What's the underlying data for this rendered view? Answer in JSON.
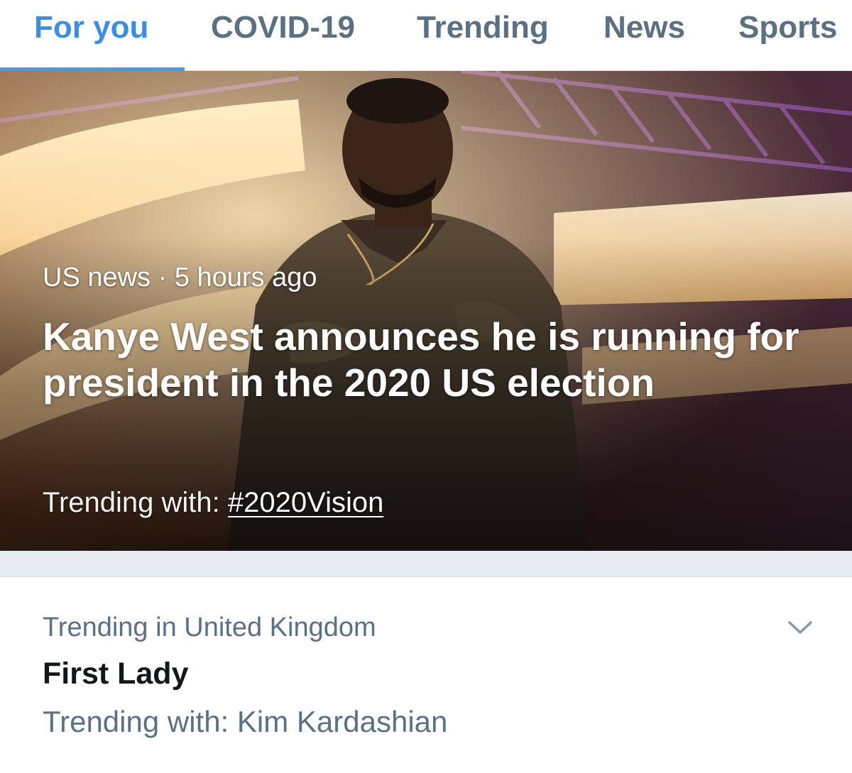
{
  "tabs": [
    {
      "label": "For you",
      "active": true
    },
    {
      "label": "COVID-19",
      "active": false
    },
    {
      "label": "Trending",
      "active": false
    },
    {
      "label": "News",
      "active": false
    },
    {
      "label": "Sports",
      "active": false
    }
  ],
  "hero": {
    "category": "US news",
    "separator": "·",
    "time": "5 hours ago",
    "headline": "Kanye West announces he is running for president in the 2020 US election",
    "trending_prefix": "Trending with:",
    "trending_hashtag": "#2020Vision"
  },
  "trend": {
    "context": "Trending in United Kingdom",
    "title": "First Lady",
    "trending_with": "Trending with: Kim Kardashian",
    "menu_icon": "chevron-down-icon"
  },
  "colors": {
    "accent": "#4a99e9",
    "tab_inactive": "#5b7083",
    "text_primary": "#14171a",
    "text_secondary": "#5b7083",
    "divider_band": "#e6ecf0"
  }
}
